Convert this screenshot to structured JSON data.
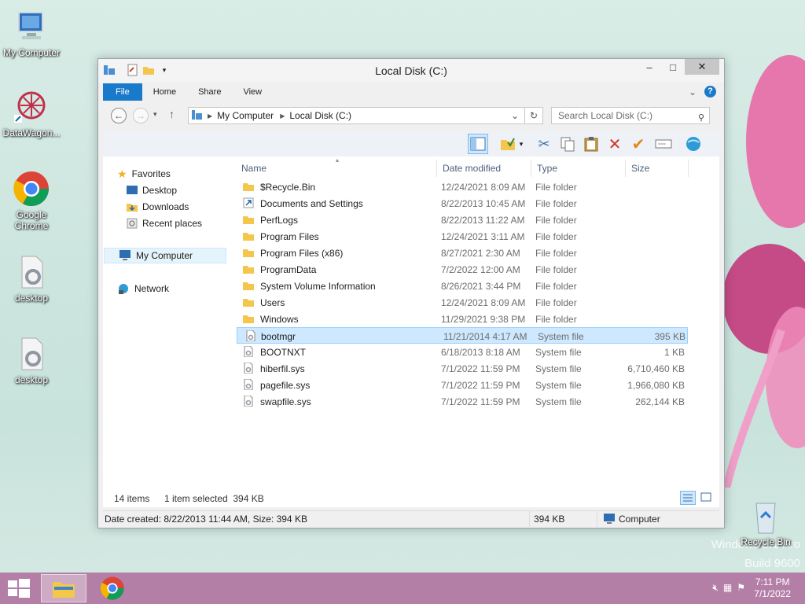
{
  "desktop": {
    "icons": [
      {
        "label": "My Computer"
      },
      {
        "label": "DataWagon..."
      },
      {
        "label": "Google Chrome"
      },
      {
        "label": "desktop"
      },
      {
        "label": "desktop"
      },
      {
        "label": "Recycle Bin"
      }
    ],
    "watermark_line1": "Windows 8.1 Pro",
    "watermark_line2": "Build 9600"
  },
  "window": {
    "title": "Local Disk (C:)",
    "controls": {
      "minimize": "–",
      "maximize": "□",
      "close": "✕"
    },
    "ribbon_tabs": [
      "File",
      "Home",
      "Share",
      "View"
    ],
    "address": {
      "segments": [
        "My Computer",
        "Local Disk (C:)"
      ]
    },
    "search_placeholder": "Search Local Disk (C:)",
    "nav_pane": {
      "favorites": "Favorites",
      "favorites_items": [
        "Desktop",
        "Downloads",
        "Recent places"
      ],
      "my_computer": "My Computer",
      "network": "Network"
    },
    "columns": {
      "name": "Name",
      "date": "Date modified",
      "type": "Type",
      "size": "Size"
    },
    "files": [
      {
        "name": "$Recycle.Bin",
        "date": "12/24/2021 8:09 AM",
        "type": "File folder",
        "size": "",
        "icon": "folder-icon"
      },
      {
        "name": "Documents and Settings",
        "date": "8/22/2013 10:45 AM",
        "type": "File folder",
        "size": "",
        "icon": "shortcut-folder-icon"
      },
      {
        "name": "PerfLogs",
        "date": "8/22/2013 11:22 AM",
        "type": "File folder",
        "size": "",
        "icon": "folder-icon"
      },
      {
        "name": "Program Files",
        "date": "12/24/2021 3:11 AM",
        "type": "File folder",
        "size": "",
        "icon": "folder-icon"
      },
      {
        "name": "Program Files (x86)",
        "date": "8/27/2021 2:30 AM",
        "type": "File folder",
        "size": "",
        "icon": "folder-icon"
      },
      {
        "name": "ProgramData",
        "date": "7/2/2022 12:00 AM",
        "type": "File folder",
        "size": "",
        "icon": "folder-icon"
      },
      {
        "name": "System Volume Information",
        "date": "8/26/2021 3:44 PM",
        "type": "File folder",
        "size": "",
        "icon": "folder-icon"
      },
      {
        "name": "Users",
        "date": "12/24/2021 8:09 AM",
        "type": "File folder",
        "size": "",
        "icon": "folder-icon"
      },
      {
        "name": "Windows",
        "date": "11/29/2021 9:38 PM",
        "type": "File folder",
        "size": "",
        "icon": "folder-icon"
      },
      {
        "name": "bootmgr",
        "date": "11/21/2014 4:17 AM",
        "type": "System file",
        "size": "395 KB",
        "icon": "system-file-icon",
        "selected": true
      },
      {
        "name": "BOOTNXT",
        "date": "6/18/2013 8:18 AM",
        "type": "System file",
        "size": "1 KB",
        "icon": "system-file-icon"
      },
      {
        "name": "hiberfil.sys",
        "date": "7/1/2022 11:59 PM",
        "type": "System file",
        "size": "6,710,460 KB",
        "icon": "system-file-icon"
      },
      {
        "name": "pagefile.sys",
        "date": "7/1/2022 11:59 PM",
        "type": "System file",
        "size": "1,966,080 KB",
        "icon": "system-file-icon"
      },
      {
        "name": "swapfile.sys",
        "date": "7/1/2022 11:59 PM",
        "type": "System file",
        "size": "262,144 KB",
        "icon": "system-file-icon"
      }
    ],
    "status": {
      "count": "14 items",
      "selection": "1 item selected  394 KB"
    },
    "details": {
      "info": "Date created: 8/22/2013 11:44 AM, Size: 394 KB",
      "size": "394 KB",
      "location": "Computer"
    }
  },
  "taskbar": {
    "time": "7:11 PM",
    "date": "7/1/2022"
  },
  "colors": {
    "accent": "#1979ca",
    "taskbar": "#b47fa6",
    "selection": "#cde8ff"
  }
}
